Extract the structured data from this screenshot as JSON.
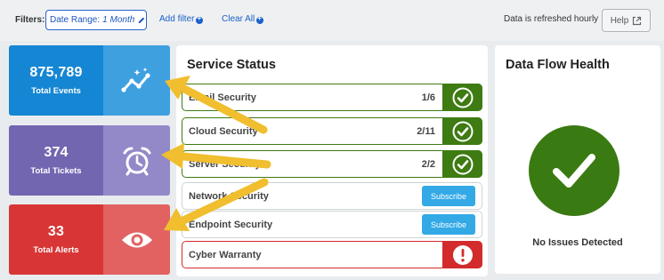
{
  "filters": {
    "label": "Filters:",
    "date_range_label": "Date Range:",
    "date_range_value": "1 Month",
    "add_filter": "Add filter",
    "clear_all": "Clear All"
  },
  "header": {
    "refresh_note": "Data is refreshed hourly",
    "help_label": "Help"
  },
  "tiles": [
    {
      "value": "875,789",
      "label": "Total Events",
      "icon": "sparkline-trend-icon"
    },
    {
      "value": "374",
      "label": "Total Tickets",
      "icon": "alarm-clock-icon"
    },
    {
      "value": "33",
      "label": "Total Alerts",
      "icon": "eye-icon"
    }
  ],
  "service_status": {
    "title": "Service Status",
    "rows": [
      {
        "name": "Email Security",
        "count": "1/6",
        "state": "ok"
      },
      {
        "name": "Cloud Security",
        "count": "2/11",
        "state": "ok"
      },
      {
        "name": "Server Security",
        "count": "2/2",
        "state": "ok"
      },
      {
        "name": "Network Security",
        "action": "Subscribe",
        "state": "subscribe"
      },
      {
        "name": "Endpoint Security",
        "action": "Subscribe",
        "state": "subscribe"
      },
      {
        "name": "Cyber Warranty",
        "state": "alert"
      }
    ]
  },
  "data_flow": {
    "title": "Data Flow Health",
    "status": "No Issues Detected"
  },
  "colors": {
    "ok_green": "#3e7b12",
    "alert_red": "#d32b2b",
    "subscribe_blue": "#33a9e6",
    "arrow_yellow": "#f0be2e"
  }
}
